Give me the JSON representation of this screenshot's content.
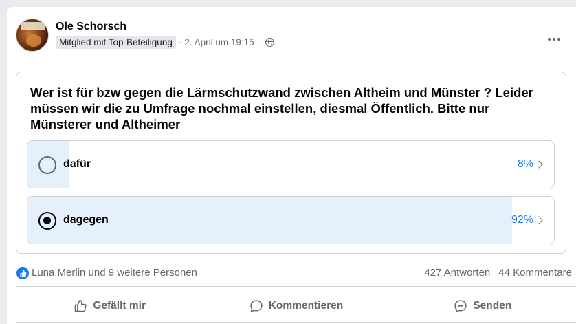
{
  "post": {
    "author": "Ole Schorsch",
    "badge": "Mitglied mit Top-Beteiligung",
    "separator": "·",
    "timestamp": "2. April um 19:15",
    "audience_icon": "globe-icon"
  },
  "poll": {
    "question": "Wer ist für bzw gegen die Lärmschutzwand zwischen Altheim und Münster ? Leider müssen wir die zu Umfrage nochmal einstellen, diesmal Öffentlich. Bitte nur Münsterer und Altheimer",
    "options": [
      {
        "label": "dafür",
        "percent": "8%",
        "fraction": 0.08,
        "selected": false
      },
      {
        "label": "dagegen",
        "percent": "92%",
        "fraction": 0.92,
        "selected": true
      }
    ]
  },
  "stats": {
    "reactors": "Luna Merlin und 9 weitere Personen",
    "answers": "427 Antworten",
    "comments": "44 Kommentare"
  },
  "actions": {
    "like": "Gefällt mir",
    "comment": "Kommentieren",
    "send": "Senden"
  },
  "colors": {
    "accent": "#1877f2",
    "fill": "#e6f0fb",
    "muted": "#65676b"
  }
}
